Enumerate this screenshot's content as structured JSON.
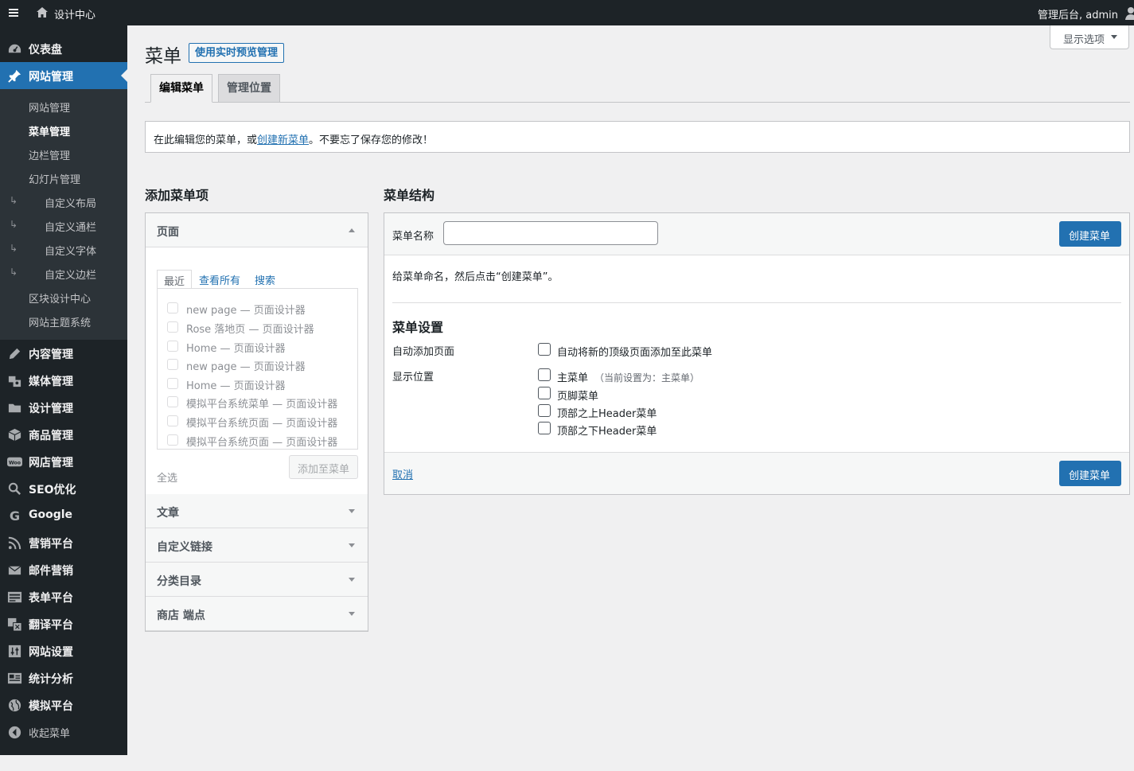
{
  "adminbar": {
    "site_name": "设计中心",
    "user_greeting": "管理后台, admin"
  },
  "sidebar": {
    "top_items": [
      {
        "label": "仪表盘",
        "icon": "dashboard-icon"
      },
      {
        "label": "网站管理",
        "icon": "pin-icon",
        "active": true
      }
    ],
    "sub_items": [
      {
        "label": "网站管理"
      },
      {
        "label": "菜单管理",
        "current": true
      },
      {
        "label": "边栏管理"
      },
      {
        "label": "幻灯片管理"
      },
      {
        "label": "自定义布局",
        "indent": true
      },
      {
        "label": "自定义通栏",
        "indent": true
      },
      {
        "label": "自定义字体",
        "indent": true
      },
      {
        "label": "自定义边栏",
        "indent": true
      },
      {
        "label": "区块设计中心"
      },
      {
        "label": "网站主题系统"
      }
    ],
    "indent_arrow": "↳",
    "bottom_items": [
      {
        "label": "内容管理",
        "icon": "pencil-icon"
      },
      {
        "label": "媒体管理",
        "icon": "media-icon"
      },
      {
        "label": "设计管理",
        "icon": "folder-icon"
      },
      {
        "label": "商品管理",
        "icon": "box-icon"
      },
      {
        "label": "网店管理",
        "icon": "woo-icon",
        "icon_text": "Woo"
      },
      {
        "label": "SEO优化",
        "icon": "search-icon"
      },
      {
        "label": "Google",
        "icon": "google-icon",
        "icon_text": "G"
      },
      {
        "label": "营销平台",
        "icon": "rss-icon"
      },
      {
        "label": "邮件营销",
        "icon": "mail-icon"
      },
      {
        "label": "表单平台",
        "icon": "form-icon"
      },
      {
        "label": "翻译平台",
        "icon": "translate-icon"
      },
      {
        "label": "网站设置",
        "icon": "settings-icon"
      },
      {
        "label": "统计分析",
        "icon": "stats-icon"
      },
      {
        "label": "模拟平台",
        "icon": "globe-icon"
      }
    ],
    "collapse_label": "收起菜单"
  },
  "header": {
    "title": "菜单",
    "live_preview_button": "使用实时预览管理",
    "screen_options": "显示选项"
  },
  "tabs": [
    {
      "label": "编辑菜单",
      "active": true
    },
    {
      "label": "管理位置",
      "active": false
    }
  ],
  "notice": {
    "before": "在此编辑您的菜单，或",
    "link": "创建新菜单",
    "after": "。不要忘了保存您的修改！"
  },
  "add_items": {
    "title": "添加菜单项",
    "sections": [
      "页面",
      "文章",
      "自定义链接",
      "分类目录",
      "商店 端点"
    ],
    "page_tabs": [
      "最近",
      "查看所有",
      "搜索"
    ],
    "pages": [
      "new page — 页面设计器",
      "Rose 落地页 — 页面设计器",
      "Home — 页面设计器",
      "new page — 页面设计器",
      "Home — 页面设计器",
      "模拟平台系统菜单 — 页面设计器",
      "模拟平台系统页面 — 页面设计器",
      "模拟平台系统页面 — 页面设计器"
    ],
    "select_all": "全选",
    "add_button": "添加至菜单"
  },
  "structure": {
    "title": "菜单结构",
    "name_label": "菜单名称",
    "name_value": "",
    "create_button": "创建菜单",
    "description": "给菜单命名，然后点击“创建菜单”。",
    "settings_title": "菜单设置",
    "auto_add_label": "自动添加页面",
    "auto_add_option": "自动将新的顶级页面添加至此菜单",
    "location_label": "显示位置",
    "locations": [
      {
        "label": "主菜单",
        "note": "（当前设置为：主菜单）"
      },
      {
        "label": "页脚菜单",
        "note": ""
      },
      {
        "label": "顶部之上Header菜单",
        "note": ""
      },
      {
        "label": "顶部之下Header菜单",
        "note": ""
      }
    ],
    "cancel_link": "取消"
  }
}
